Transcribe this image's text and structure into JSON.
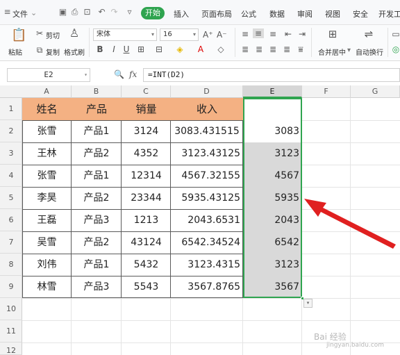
{
  "menubar": {
    "file_label": "文件",
    "start_tab": "开始",
    "tabs": [
      "插入",
      "页面布局",
      "公式",
      "数据",
      "审阅",
      "视图",
      "安全",
      "开发工"
    ]
  },
  "ribbon": {
    "paste_label": "粘贴",
    "cut_label": "剪切",
    "copy_label": "复制",
    "format_painter_label": "格式刷",
    "font_name": "宋体",
    "font_size": "16",
    "merge_center_label": "合并居中",
    "wrap_text_label": "自动换行"
  },
  "formula_bar": {
    "name_box": "E2",
    "fx_label": "fx",
    "formula": "=INT(D2)"
  },
  "columns": [
    "A",
    "B",
    "C",
    "D",
    "E",
    "F",
    "G"
  ],
  "selected_column": "E",
  "rows": [
    "1",
    "2",
    "3",
    "4",
    "5",
    "6",
    "7",
    "8",
    "9",
    "10",
    "11",
    "12"
  ],
  "table": {
    "headers": [
      "姓名",
      "产品",
      "销量",
      "收入"
    ],
    "rows": [
      {
        "name": "张雪",
        "product": "产品1",
        "sales": "3124",
        "income": "3083.431515",
        "result": "3083"
      },
      {
        "name": "王林",
        "product": "产品2",
        "sales": "4352",
        "income": "3123.43125",
        "result": "3123"
      },
      {
        "name": "张雪",
        "product": "产品1",
        "sales": "12314",
        "income": "4567.32155",
        "result": "4567"
      },
      {
        "name": "李昊",
        "product": "产品2",
        "sales": "23344",
        "income": "5935.43125",
        "result": "5935"
      },
      {
        "name": "王磊",
        "product": "产品3",
        "sales": "1213",
        "income": "2043.6531",
        "result": "2043"
      },
      {
        "name": "吴雪",
        "product": "产品2",
        "sales": "43124",
        "income": "6542.34524",
        "result": "6542"
      },
      {
        "name": "刘伟",
        "product": "产品1",
        "sales": "5432",
        "income": "3123.4315",
        "result": "3123"
      },
      {
        "name": "林雪",
        "product": "产品3",
        "sales": "5543",
        "income": "3567.8765",
        "result": "3567"
      }
    ]
  },
  "colors": {
    "header_fill": "#f4b183",
    "selection_border": "#2fa44f",
    "selection_fill": "#d9d9d9",
    "arrow": "#e02020"
  },
  "watermark": "Bai 经验",
  "watermark_url": "jingyan.baidu.com"
}
